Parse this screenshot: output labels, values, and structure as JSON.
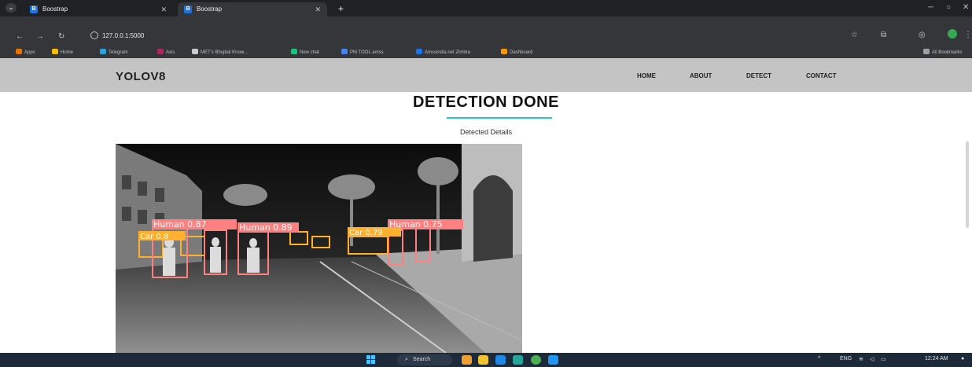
{
  "browser": {
    "tabs": [
      {
        "title": "Boostrap",
        "favicon": "B",
        "active": false
      },
      {
        "title": "Boostrap",
        "favicon": "B",
        "active": true
      }
    ],
    "url": "127.0.0.1:5000",
    "bookmarks": [
      {
        "label": "Apps",
        "color": "#e37400"
      },
      {
        "label": "Home",
        "color": "#fbbc04"
      },
      {
        "label": "Telegram",
        "color": "#2aa3e0"
      },
      {
        "label": "Axis",
        "color": "#ae275f"
      },
      {
        "label": "MET's Bhujbal Know...",
        "color": "#cccccc"
      },
      {
        "label": "New chat",
        "color": "#19c37d"
      },
      {
        "label": "PM TOOL amss",
        "color": "#4285f4"
      },
      {
        "label": "Amssindia.net Zimbra",
        "color": "#1a73e8"
      },
      {
        "label": "Dashboard",
        "color": "#ff9800"
      }
    ],
    "all_bookmarks_label": "All Bookmarks"
  },
  "site": {
    "brand": "YOLOV8",
    "nav": [
      "HOME",
      "ABOUT",
      "DETECT",
      "CONTACT"
    ]
  },
  "content": {
    "heading": "DETECTION DONE",
    "subheading": "Detected Details",
    "detections": [
      {
        "label": "Human 0.87",
        "color": "#ff8080"
      },
      {
        "label": "Human 0.89",
        "color": "#ff8080"
      },
      {
        "label": "Human 0.75",
        "color": "#ff8080"
      },
      {
        "label": "Car 0.8",
        "color": "#ffb02e"
      },
      {
        "label": "Car 0.79",
        "color": "#ffb02e"
      }
    ]
  },
  "taskbar": {
    "search_label": "Search",
    "lang": "ENG",
    "time": "12:24 AM"
  },
  "colors": {
    "accent_line": "#2cc3d2",
    "nav_bg": "#c4c4c4",
    "human_box": "#ff8080",
    "car_box": "#ffb02e"
  }
}
